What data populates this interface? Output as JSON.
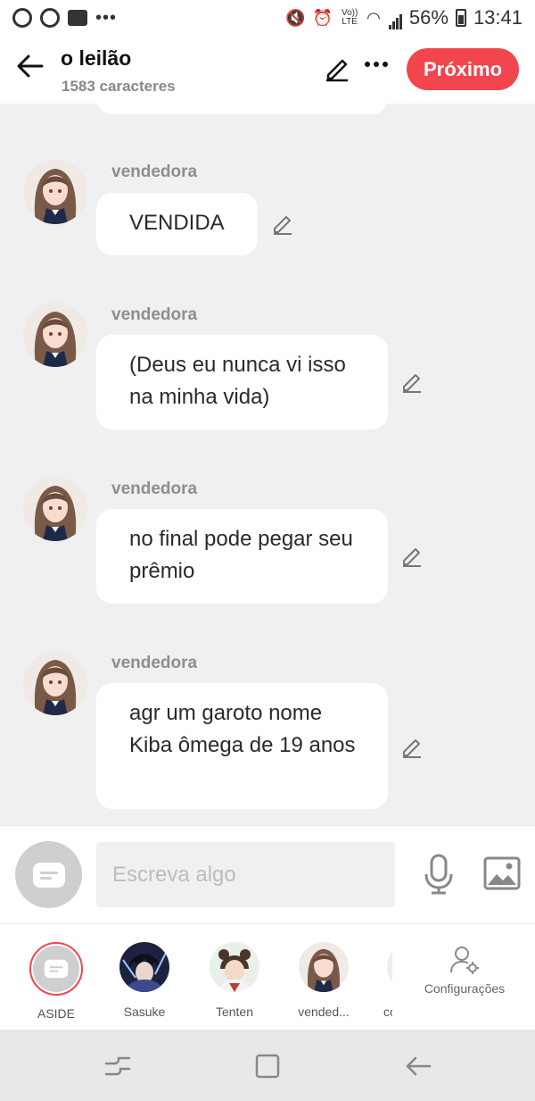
{
  "status_bar": {
    "battery": "56%",
    "time": "13:41",
    "network": "Vo)) LTE"
  },
  "header": {
    "title": "o leilão",
    "subtitle": "1583 caracteres",
    "next_label": "Próximo",
    "accent_color": "#f2454d"
  },
  "messages": [
    {
      "sender": "vendedora",
      "text": "VENDIDA"
    },
    {
      "sender": "vendedora",
      "text": "(Deus eu nunca vi isso na minha vida)"
    },
    {
      "sender": "vendedora",
      "text": "no final pode pegar seu prêmio"
    },
    {
      "sender": "vendedora",
      "text": "agr um garoto nome Kiba ômega de 19 anos"
    }
  ],
  "composer": {
    "placeholder": "Escreva algo"
  },
  "characters": [
    {
      "label": "ASIDE"
    },
    {
      "label": "Sasuke"
    },
    {
      "label": "Tenten"
    },
    {
      "label": "vended..."
    },
    {
      "label": "co"
    }
  ],
  "settings_label": "Configurações"
}
